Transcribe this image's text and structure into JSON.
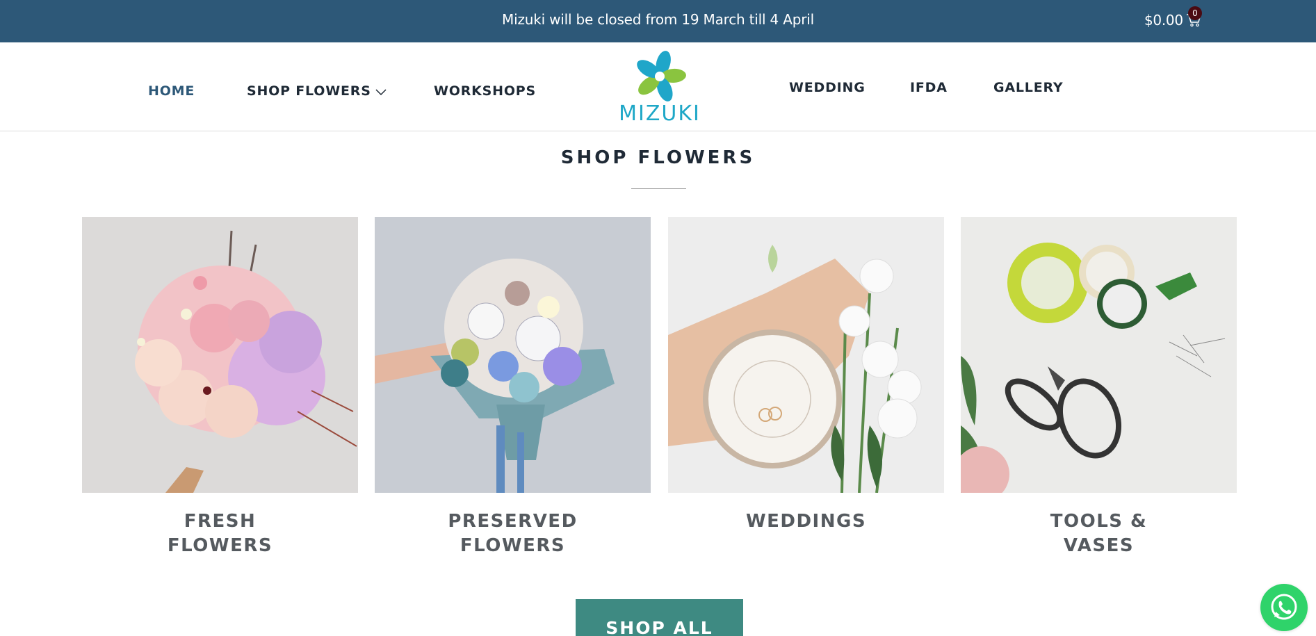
{
  "topbar": {
    "announcement": "Mizuki will be closed from 19 March till 4 April",
    "cart_amount": "$0.00",
    "cart_count": "0",
    "background": "#2d5878"
  },
  "nav": {
    "left_items": [
      {
        "label": "HOME",
        "active": true
      },
      {
        "label": "SHOP FLOWERS",
        "dropdown": true
      },
      {
        "label": "WORKSHOPS"
      }
    ],
    "right_items": [
      {
        "label": "WEDDING"
      },
      {
        "label": "IFDA"
      },
      {
        "label": "GALLERY"
      }
    ],
    "logo_text": "MIZUKI",
    "active_color": "#2d5878"
  },
  "section": {
    "title": "SHOP FLOWERS"
  },
  "categories": [
    {
      "line1": "FRESH",
      "line2": "FLOWERS",
      "image": "pink-bouquet-photo"
    },
    {
      "line1": "PRESERVED",
      "line2": "FLOWERS",
      "image": "preserved-bouquet-photo"
    },
    {
      "line1": "WEDDINGS",
      "line2": "",
      "image": "wedding-rings-plate-photo"
    },
    {
      "line1": "TOOLS &",
      "line2": "VASES",
      "image": "floral-tape-scissors-photo"
    }
  ],
  "cta": {
    "label": "SHOP ALL",
    "color": "#3e8a82"
  },
  "whatsapp": {
    "icon": "whatsapp-icon",
    "color": "#2fd36a"
  }
}
